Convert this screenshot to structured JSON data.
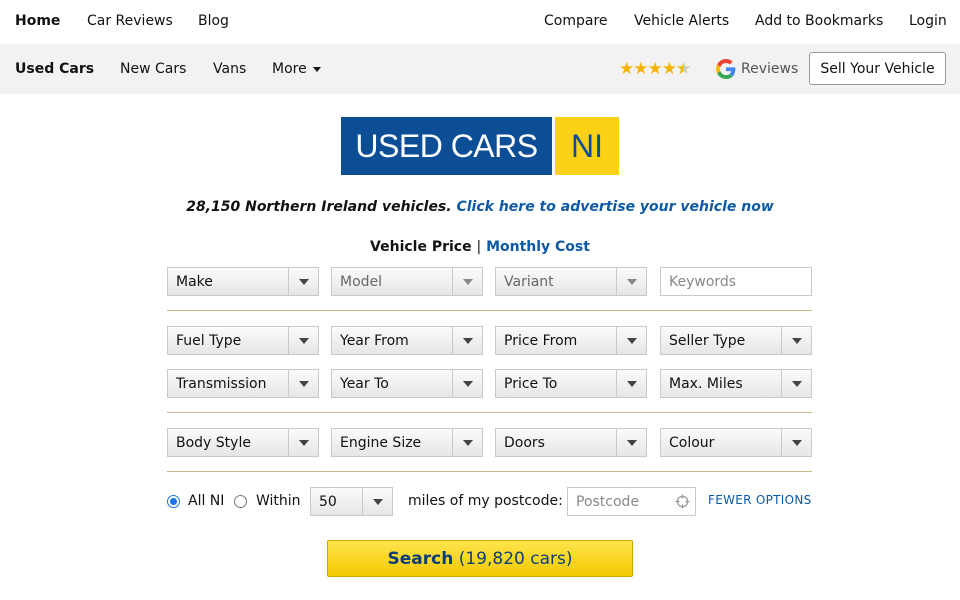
{
  "topnav": {
    "home": "Home",
    "car_reviews": "Car Reviews",
    "blog": "Blog",
    "compare": "Compare",
    "vehicle_alerts": "Vehicle Alerts",
    "add_bookmarks": "Add to Bookmarks",
    "login": "Login"
  },
  "subnav": {
    "used_cars": "Used Cars",
    "new_cars": "New Cars",
    "vans": "Vans",
    "more": "More",
    "rating_stars": 4.5,
    "reviews_label": "Reviews",
    "sell_label": "Sell Your Vehicle"
  },
  "logo": {
    "left": "USED CARS",
    "right": "NI",
    "primary_color": "#0c4e96",
    "accent_color": "#fcd116"
  },
  "tagline": {
    "count_text": "28,150 Northern Ireland vehicles.",
    "link_text": "Click here to advertise your vehicle now"
  },
  "price_toggle": {
    "vehicle_price": "Vehicle Price",
    "separator": "|",
    "monthly_cost": "Monthly Cost"
  },
  "filters": {
    "make": "Make",
    "model": "Model",
    "variant": "Variant",
    "keywords_placeholder": "Keywords",
    "fuel_type": "Fuel Type",
    "year_from": "Year From",
    "price_from": "Price From",
    "seller_type": "Seller Type",
    "transmission": "Transmission",
    "year_to": "Year To",
    "price_to": "Price To",
    "max_miles": "Max. Miles",
    "body_style": "Body Style",
    "engine_size": "Engine Size",
    "doors": "Doors",
    "colour": "Colour"
  },
  "location": {
    "all_ni": "All NI",
    "within": "Within",
    "distance": "50",
    "miles_text": "miles of my postcode:",
    "postcode_placeholder": "Postcode",
    "fewer_options": "FEWER OPTIONS"
  },
  "search": {
    "label": "Search",
    "count": "(19,820 cars)"
  }
}
